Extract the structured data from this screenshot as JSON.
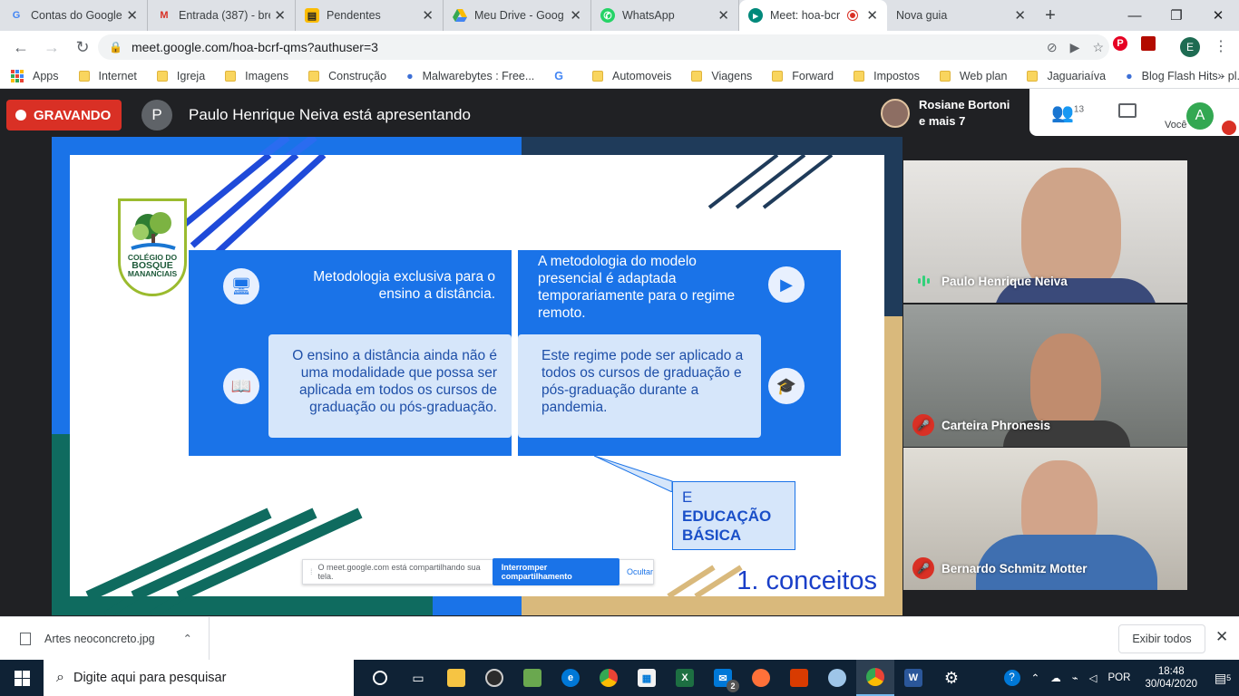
{
  "browser": {
    "tabs": [
      {
        "title": "Contas do Google",
        "icon": "google-icon"
      },
      {
        "title": "Entrada (387) - bre",
        "icon": "gmail-icon"
      },
      {
        "title": "Pendentes",
        "icon": "keep-icon"
      },
      {
        "title": "Meu Drive - Goog",
        "icon": "drive-icon"
      },
      {
        "title": "WhatsApp",
        "icon": "whatsapp-icon"
      },
      {
        "title": "Meet: hoa-bcr",
        "icon": "meet-icon",
        "active": true
      },
      {
        "title": "Nova guia",
        "icon": ""
      }
    ],
    "url": "meet.google.com/hoa-bcrf-qms?authuser=3",
    "profile_initial": "E",
    "bookmarks": [
      {
        "label": "Apps",
        "type": "apps"
      },
      {
        "label": "Internet",
        "type": "folder"
      },
      {
        "label": "Igreja",
        "type": "folder"
      },
      {
        "label": "Imagens",
        "type": "folder"
      },
      {
        "label": "Construção",
        "type": "folder"
      },
      {
        "label": "Malwarebytes : Free...",
        "type": "site"
      },
      {
        "label": "",
        "type": "google"
      },
      {
        "label": "Automoveis",
        "type": "folder"
      },
      {
        "label": "Viagens",
        "type": "folder"
      },
      {
        "label": "Forward",
        "type": "folder"
      },
      {
        "label": "Impostos",
        "type": "folder"
      },
      {
        "label": "Web plan",
        "type": "folder"
      },
      {
        "label": "Jaguariaíva",
        "type": "folder"
      },
      {
        "label": "Blog Flash Hits - pl...",
        "type": "site"
      }
    ]
  },
  "meet": {
    "recording_label": "GRAVANDO",
    "presenter_initial": "P",
    "presenter_text": "Paulo Henrique Neiva está apresentando",
    "participants_line1": "Rosiane Bortoni",
    "participants_line2": "e mais 7",
    "participant_count": "13",
    "you_label": "Você",
    "you_initial": "A",
    "tiles": [
      {
        "name": "Paulo Henrique Neiva",
        "state": "speaking"
      },
      {
        "name": "Carteira Phronesis",
        "state": "muted"
      },
      {
        "name": "Bernardo Schmitz Motter",
        "state": "muted"
      }
    ]
  },
  "slide": {
    "logo_line1": "COLÉGIO DO",
    "logo_line2": "BOSQUE",
    "logo_line3": "MANANCIAIS",
    "left_head": "Metodologia exclusiva para o ensino a distância.",
    "left_box": "O ensino a distância ainda não é uma modalidade que possa ser aplicada em todos os cursos de graduação ou pós-graduação.",
    "right_head": "A metodologia do modelo presencial é adaptada temporariamente para o regime remoto.",
    "right_box": "Este regime pode ser aplicado a todos os cursos de graduação e pós-graduação durante a pandemia.",
    "callout_e": "E",
    "callout_text": "EDUCAÇÃO BÁSICA",
    "footer": "1. conceitos",
    "share_text": "O meet.google.com está compartilhando sua tela.",
    "share_stop": "Interromper compartilhamento",
    "share_hide": "Ocultar"
  },
  "downloads": {
    "file": "Artes neoconcreto.jpg",
    "show_all": "Exibir todos"
  },
  "taskbar": {
    "search_placeholder": "Digite aqui para pesquisar",
    "lang": "POR",
    "time": "18:48",
    "date": "30/04/2020",
    "notifications": "5",
    "mail_badge": "2"
  }
}
